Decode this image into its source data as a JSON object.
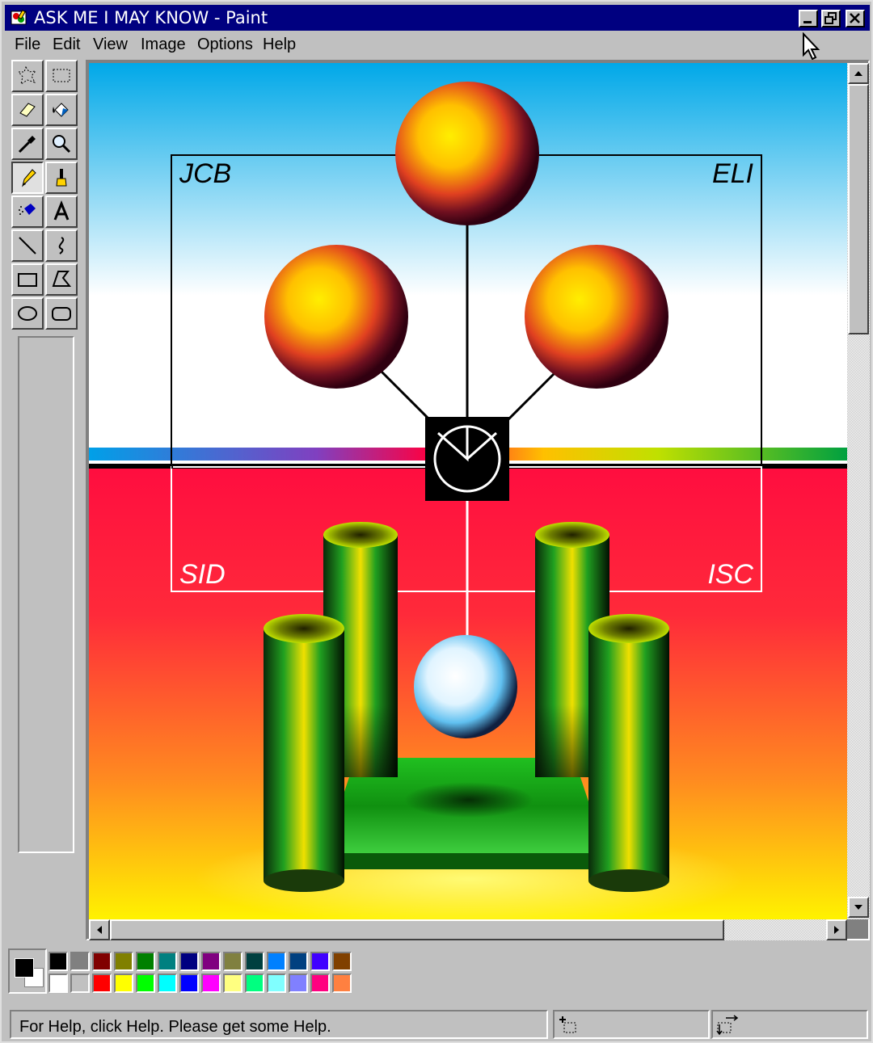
{
  "window": {
    "title": "ASK ME I MAY KNOW - Paint",
    "title_bar_color": "#000080"
  },
  "menu": [
    {
      "label": "File"
    },
    {
      "label": "Edit"
    },
    {
      "label": "View"
    },
    {
      "label": "Image"
    },
    {
      "label": "Options"
    },
    {
      "label": "Help"
    }
  ],
  "tools": [
    "free-select-icon",
    "rect-select-icon",
    "eraser-icon",
    "fill-bucket-icon",
    "color-picker-icon",
    "magnifier-icon",
    "pencil-icon",
    "brush-icon",
    "airbrush-icon",
    "text-icon",
    "line-icon",
    "curve-icon",
    "rectangle-icon",
    "polygon-icon",
    "ellipse-icon",
    "rounded-rect-icon"
  ],
  "canvas": {
    "labels": {
      "top_left": "JCB",
      "top_right": "ELI",
      "bottom_left": "SID",
      "bottom_right": "ISC"
    },
    "sky_top": "#00a8e8",
    "floor_top": "#ff0a40",
    "floor_bottom": "#fff200"
  },
  "palette": {
    "foreground": "#000000",
    "background": "#ffffff",
    "row1": [
      "#000000",
      "#808080",
      "#800000",
      "#808000",
      "#008000",
      "#008080",
      "#000080",
      "#800080",
      "#808040",
      "#004040",
      "#0080ff",
      "#004080",
      "#4000ff",
      "#804000"
    ],
    "row2": [
      "#ffffff",
      "#c0c0c0",
      "#ff0000",
      "#ffff00",
      "#00ff00",
      "#00ffff",
      "#0000ff",
      "#ff00ff",
      "#ffff80",
      "#00ff80",
      "#80ffff",
      "#8080ff",
      "#ff0080",
      "#ff8040"
    ]
  },
  "status": {
    "help_text": "For Help, click Help. Please get some Help."
  }
}
